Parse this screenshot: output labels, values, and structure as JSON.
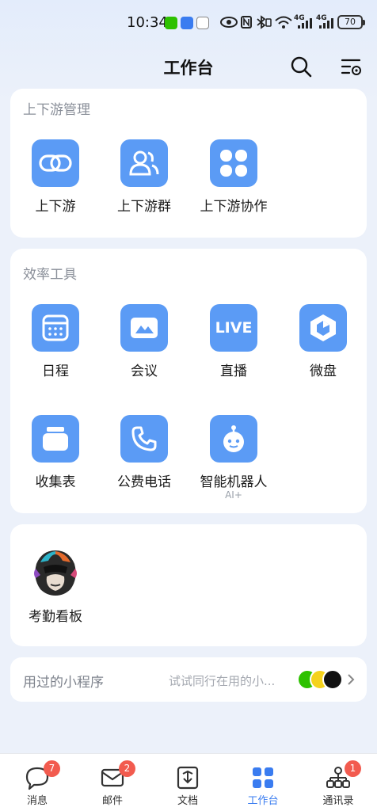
{
  "status_bar": {
    "time": "10:34",
    "network_a": "4G",
    "network_b": "4G",
    "battery": "70"
  },
  "header": {
    "title": "工作台"
  },
  "sections": {
    "upstream": {
      "title": "上下游管理",
      "items": [
        {
          "label": "上下游",
          "icon": "link-rings-icon"
        },
        {
          "label": "上下游群",
          "icon": "group-people-icon"
        },
        {
          "label": "上下游协作",
          "icon": "four-petal-icon"
        }
      ]
    },
    "efficiency": {
      "title": "效率工具",
      "items": [
        {
          "label": "日程",
          "icon": "calendar-icon"
        },
        {
          "label": "会议",
          "icon": "meeting-icon"
        },
        {
          "label": "直播",
          "icon": "live-icon",
          "icon_text": "LIVE"
        },
        {
          "label": "微盘",
          "icon": "drive-icon"
        },
        {
          "label": "收集表",
          "icon": "collect-form-icon"
        },
        {
          "label": "公费电话",
          "icon": "phone-icon"
        },
        {
          "label": "智能机器人",
          "icon": "robot-icon",
          "tag": "AI+"
        }
      ]
    },
    "apps": {
      "items": [
        {
          "label": "考勤看板",
          "icon": "monkey-logo-icon"
        }
      ]
    },
    "mini_programs": {
      "title": "用过的小程序",
      "hint": "试试同行在用的小..."
    }
  },
  "tabbar": {
    "items": [
      {
        "label": "消息",
        "badge": "7",
        "icon": "chat-bubble-icon"
      },
      {
        "label": "邮件",
        "badge": "2",
        "icon": "mail-icon"
      },
      {
        "label": "文档",
        "badge": "",
        "icon": "document-icon"
      },
      {
        "label": "工作台",
        "badge": "",
        "icon": "workbench-grid-icon",
        "active": true
      },
      {
        "label": "通讯录",
        "badge": "1",
        "icon": "org-chart-icon"
      }
    ]
  },
  "colors": {
    "accent": "#3A7CF0",
    "icon_bg": "#5B9BF5",
    "badge": "#F25B4F",
    "page_bg": "#ECF1FA"
  }
}
